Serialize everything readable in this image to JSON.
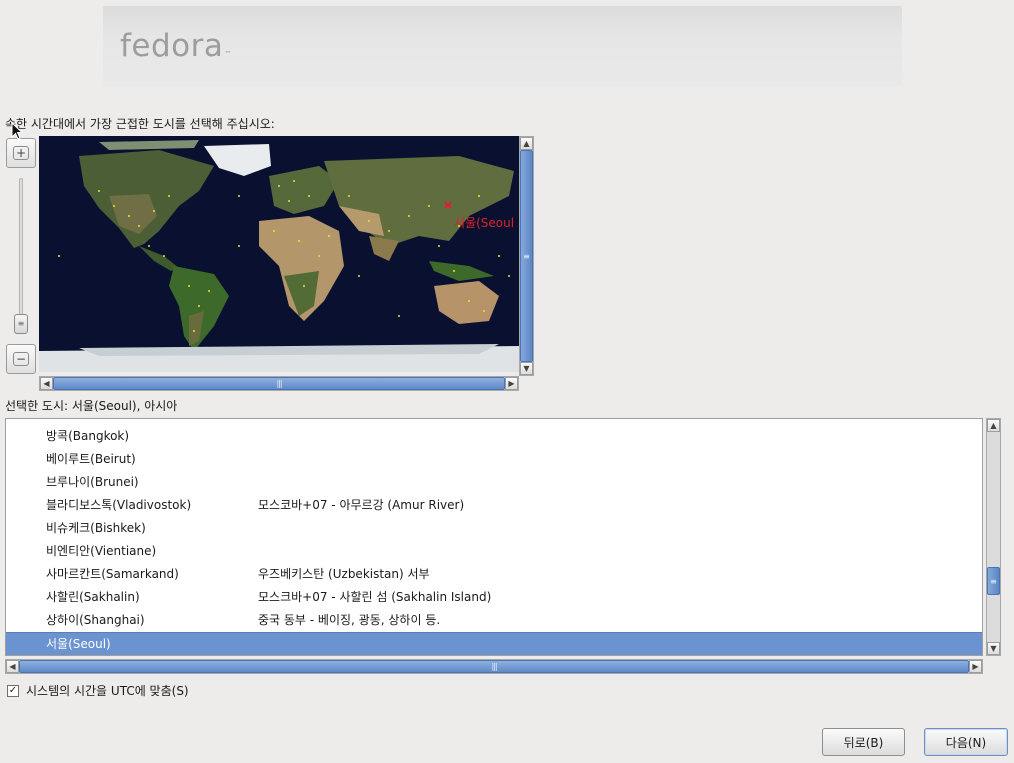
{
  "header": {
    "logo_text": "fedora",
    "logo_tm": "™"
  },
  "prompt": "속한 시간대에서 가장 근접한 도시를 선택해 주십시오:",
  "map": {
    "marker_label": "서울(Seoul",
    "marker_color": "#e0202a",
    "ocean_color": "#0a1030"
  },
  "selected_city": "선택한 도시: 서울(Seoul), 아시아",
  "list": {
    "rows": [
      {
        "city": "방콕(Bangkok)",
        "desc": ""
      },
      {
        "city": "베이루트(Beirut)",
        "desc": ""
      },
      {
        "city": "브루나이(Brunei)",
        "desc": ""
      },
      {
        "city": "블라디보스톡(Vladivostok)",
        "desc": "모스코바+07 - 아무르강 (Amur River)"
      },
      {
        "city": "비슈케크(Bishkek)",
        "desc": ""
      },
      {
        "city": "비엔티안(Vientiane)",
        "desc": ""
      },
      {
        "city": "사마르칸트(Samarkand)",
        "desc": "우즈베키스탄 (Uzbekistan) 서부"
      },
      {
        "city": "사할린(Sakhalin)",
        "desc": "모스크바+07 - 사할린 섬 (Sakhalin Island)"
      },
      {
        "city": "상하이(Shanghai)",
        "desc": "중국 동부 - 베이징, 광동, 상하이 등."
      },
      {
        "city": "서울(Seoul)",
        "desc": ""
      }
    ],
    "selected_color": "#6a93cf"
  },
  "utc": {
    "label": "시스템의 시간을 UTC에 맞춤(S)",
    "checked": "✓"
  },
  "buttons": {
    "back": "뒤로(B)",
    "next": "다음(N)"
  }
}
